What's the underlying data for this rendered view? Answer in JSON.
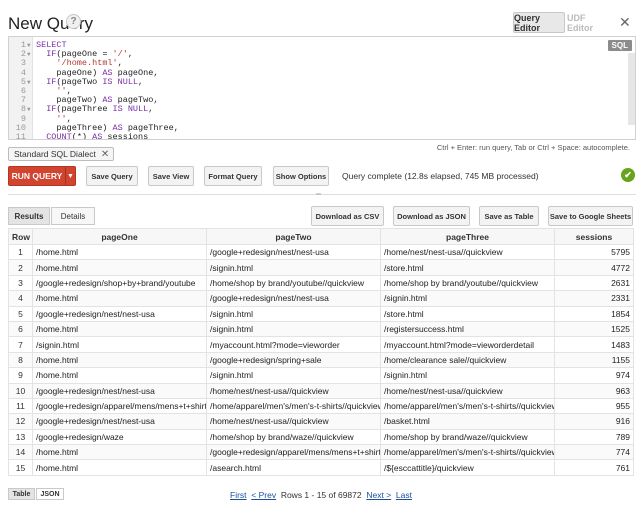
{
  "header": {
    "title": "New Query",
    "help_icon": "?",
    "tabs": [
      {
        "label": "Query Editor",
        "active": true
      },
      {
        "label": "UDF Editor",
        "active": false
      }
    ],
    "close_icon": "✕"
  },
  "editor": {
    "badge": "SQL",
    "lines": [
      {
        "n": "1",
        "fold": true
      },
      {
        "n": "2",
        "fold": true
      },
      {
        "n": "3",
        "fold": false
      },
      {
        "n": "4",
        "fold": false
      },
      {
        "n": "5",
        "fold": true
      },
      {
        "n": "6",
        "fold": false
      },
      {
        "n": "7",
        "fold": false
      },
      {
        "n": "8",
        "fold": true
      },
      {
        "n": "9",
        "fold": false
      },
      {
        "n": "10",
        "fold": false
      },
      {
        "n": "11",
        "fold": false
      }
    ],
    "hint": "Ctrl + Enter: run query, Tab or Ctrl + Space: autocomplete."
  },
  "dialect_chip": {
    "label": "Standard SQL Dialect",
    "remove_icon": "✕"
  },
  "actions": {
    "run": "RUN QUERY",
    "save_query": "Save Query",
    "save_view": "Save View",
    "format_query": "Format Query",
    "show_options": "Show Options",
    "status": "Query complete (12.8s elapsed, 745 MB processed)",
    "status_icon": "✔"
  },
  "result_tabs": [
    {
      "label": "Results",
      "active": true
    },
    {
      "label": "Details",
      "active": false
    }
  ],
  "downloads": {
    "csv": "Download as CSV",
    "json": "Download as JSON",
    "table": "Save as Table",
    "sheets": "Save to Google Sheets"
  },
  "table": {
    "headers": [
      "Row",
      "pageOne",
      "pageTwo",
      "pageThree",
      "sessions"
    ],
    "rows": [
      [
        "1",
        "/home.html",
        "/google+redesign/nest/nest-usa",
        "/home/nest/nest-usa//quickview",
        "5795"
      ],
      [
        "2",
        "/home.html",
        "/signin.html",
        "/store.html",
        "4772"
      ],
      [
        "3",
        "/google+redesign/shop+by+brand/youtube",
        "/home/shop by brand/youtube//quickview",
        "/home/shop by brand/youtube//quickview",
        "2631"
      ],
      [
        "4",
        "/home.html",
        "/google+redesign/nest/nest-usa",
        "/signin.html",
        "2331"
      ],
      [
        "5",
        "/google+redesign/nest/nest-usa",
        "/signin.html",
        "/store.html",
        "1854"
      ],
      [
        "6",
        "/home.html",
        "/signin.html",
        "/registersuccess.html",
        "1525"
      ],
      [
        "7",
        "/signin.html",
        "/myaccount.html?mode=vieworder",
        "/myaccount.html?mode=vieworderdetail",
        "1483"
      ],
      [
        "8",
        "/home.html",
        "/google+redesign/spring+sale",
        "/home/clearance sale//quickview",
        "1155"
      ],
      [
        "9",
        "/home.html",
        "/signin.html",
        "/signin.html",
        "974"
      ],
      [
        "10",
        "/google+redesign/nest/nest-usa",
        "/home/nest/nest-usa//quickview",
        "/home/nest/nest-usa//quickview",
        "963"
      ],
      [
        "11",
        "/google+redesign/apparel/mens/mens+t+shirts",
        "/home/apparel/men's/men's-t-shirts//quickview",
        "/home/apparel/men's/men's-t-shirts//quickview",
        "955"
      ],
      [
        "12",
        "/google+redesign/nest/nest-usa",
        "/home/nest/nest-usa//quickview",
        "/basket.html",
        "916"
      ],
      [
        "13",
        "/google+redesign/waze",
        "/home/shop by brand/waze//quickview",
        "/home/shop by brand/waze//quickview",
        "789"
      ],
      [
        "14",
        "/home.html",
        "/google+redesign/apparel/mens/mens+t+shirts",
        "/home/apparel/men's/men's-t-shirts//quickview",
        "774"
      ],
      [
        "15",
        "/home.html",
        "/asearch.html",
        "/${esccattitle}/quickview",
        "761"
      ]
    ]
  },
  "footer": {
    "view_tabs": [
      {
        "label": "Table",
        "active": true
      },
      {
        "label": "JSON",
        "active": false
      }
    ],
    "first": "First",
    "prev": "< Prev",
    "rows_info": "Rows 1 - 15 of 69872",
    "next": "Next >",
    "last": "Last"
  }
}
